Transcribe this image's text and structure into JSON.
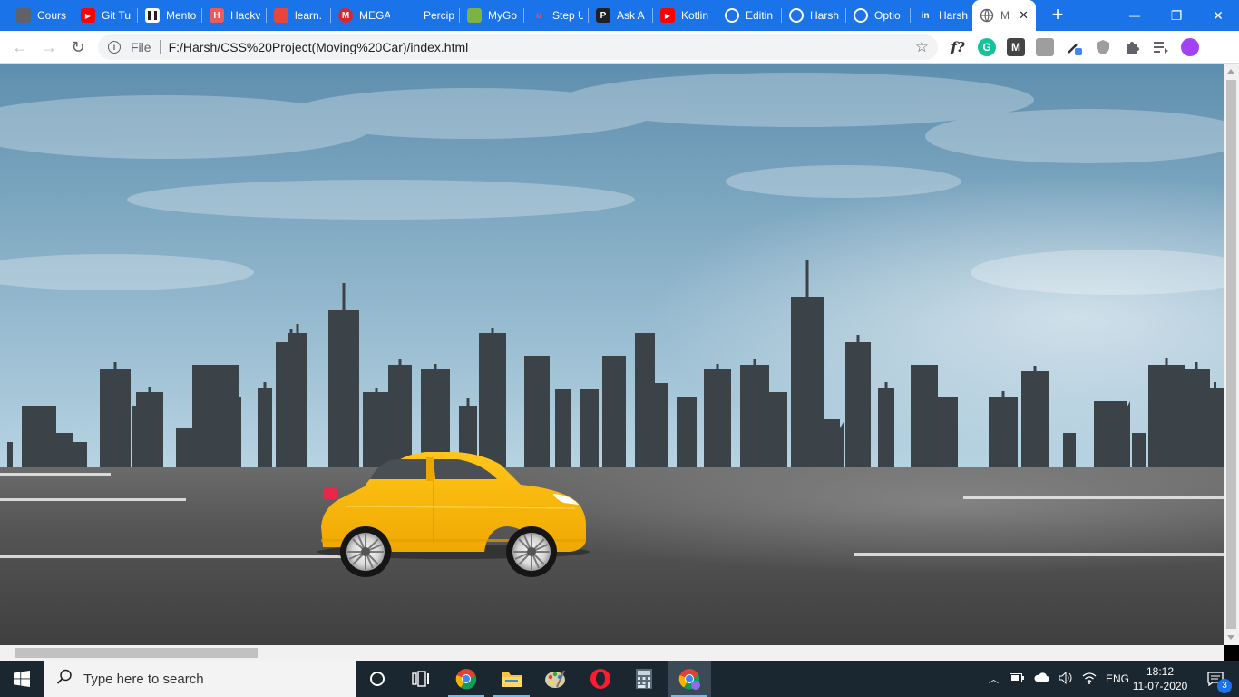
{
  "browser": {
    "tabs": [
      {
        "title": "Cours",
        "icon": "course-icon",
        "color": "#5f6368"
      },
      {
        "title": "Git Tu",
        "icon": "youtube-icon",
        "color": "#ff0000"
      },
      {
        "title": "Mento",
        "icon": "trello-icon",
        "color": "#ffffff"
      },
      {
        "title": "Hackv",
        "icon": "hackerrank-icon",
        "color": "#ec5b5b"
      },
      {
        "title": "learn.",
        "icon": "learn-icon",
        "color": "#e8453c"
      },
      {
        "title": "MEGA",
        "icon": "mega-icon",
        "color": "#d9272e"
      },
      {
        "title": "Percip",
        "icon": "percipio-icon",
        "color": "#1a73e8"
      },
      {
        "title": "MyGo",
        "icon": "mygov-icon",
        "color": "#7cb342"
      },
      {
        "title": "Step U",
        "icon": "udemy-icon",
        "color": "#ec5252"
      },
      {
        "title": "Ask A",
        "icon": "ask-icon",
        "color": "#202124"
      },
      {
        "title": "Kotlin",
        "icon": "youtube-icon",
        "color": "#ff0000"
      },
      {
        "title": "Editin",
        "icon": "github-icon",
        "color": "#ffffff"
      },
      {
        "title": "Harsh",
        "icon": "github-icon",
        "color": "#ffffff"
      },
      {
        "title": "Optio",
        "icon": "github-icon",
        "color": "#ffffff"
      },
      {
        "title": "Harsh",
        "icon": "linkedin-icon",
        "color": "#ffffff"
      }
    ],
    "active_tab": {
      "title": "M",
      "icon": "globe-icon"
    },
    "newtab_label": "+",
    "window_controls": {
      "minimize": "—",
      "restore": "❐",
      "close": "✕"
    },
    "nav": {
      "back": "←",
      "forward": "→",
      "reload": "↻"
    },
    "address": {
      "scheme_label": "File",
      "url": "F:/Harsh/CSS%20Project(Moving%20Car)/index.html"
    },
    "extensions": [
      {
        "label": "f?",
        "icon": "formula-icon"
      },
      {
        "label": "G",
        "icon": "grammarly-icon"
      },
      {
        "label": "M",
        "icon": "mendeley-icon"
      },
      {
        "label": "",
        "icon": "pdf-icon"
      },
      {
        "label": "",
        "icon": "eyedropper-icon"
      },
      {
        "label": "",
        "icon": "shield-icon"
      },
      {
        "label": "",
        "icon": "puzzle-icon"
      },
      {
        "label": "",
        "icon": "media-queue-icon"
      },
      {
        "label": "",
        "icon": "profile-avatar-icon"
      }
    ]
  },
  "scene": {
    "sky_top": "#5e8fae",
    "sky_bottom": "#b8d4e3",
    "skyline_color": "#3b4248",
    "road_color": "#4a4a4a",
    "lane_color": "#e6e6e6",
    "car_body": "#f7b500",
    "car_window": "#4a4f55",
    "wheel_rim": "#e8e8e8"
  },
  "taskbar": {
    "search_placeholder": "Type here to search",
    "apps": [
      "task-view-icon",
      "chrome-icon",
      "file-explorer-icon",
      "paint-icon",
      "opera-icon",
      "calculator-icon",
      "chrome-canary-icon"
    ],
    "language": "ENG",
    "time": "18:12",
    "date": "11-07-2020",
    "notification_count": "3"
  }
}
